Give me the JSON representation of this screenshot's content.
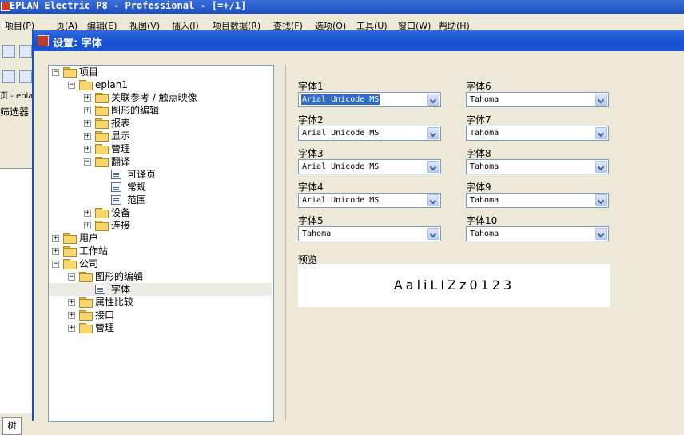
{
  "app": {
    "title": "EPLAN Electric P8 - Professional - [=+/1]",
    "menu": [
      "项目(P)",
      "页(A)",
      "编辑(E)",
      "视图(V)",
      "插入(I)",
      "项目数据(R)",
      "查找(F)",
      "选项(O)",
      "工具(U)",
      "窗口(W)",
      "帮助(H)"
    ],
    "left_text_1": "页 - eplan",
    "left_text_2": "筛选器",
    "tab_tree": "树"
  },
  "dialog": {
    "title": "设置: 字体",
    "tree": [
      {
        "label": "项目",
        "level": 0,
        "exp": "-",
        "icon": "folder"
      },
      {
        "label": "eplan1",
        "level": 1,
        "exp": "-",
        "icon": "folder"
      },
      {
        "label": "关联参考 / 触点映像",
        "level": 2,
        "exp": "+",
        "icon": "folder"
      },
      {
        "label": "图形的编辑",
        "level": 2,
        "exp": "+",
        "icon": "folder"
      },
      {
        "label": "报表",
        "level": 2,
        "exp": "+",
        "icon": "folder"
      },
      {
        "label": "显示",
        "level": 2,
        "exp": "+",
        "icon": "folder"
      },
      {
        "label": "管理",
        "level": 2,
        "exp": "+",
        "icon": "folder"
      },
      {
        "label": "翻译",
        "level": 2,
        "exp": "-",
        "icon": "folder"
      },
      {
        "label": "可译页",
        "level": 3,
        "exp": "",
        "icon": "page"
      },
      {
        "label": "常规",
        "level": 3,
        "exp": "",
        "icon": "page"
      },
      {
        "label": "范围",
        "level": 3,
        "exp": "",
        "icon": "page"
      },
      {
        "label": "设备",
        "level": 2,
        "exp": "+",
        "icon": "folder"
      },
      {
        "label": "连接",
        "level": 2,
        "exp": "+",
        "icon": "folder"
      },
      {
        "label": "用户",
        "level": 0,
        "exp": "+",
        "icon": "folder"
      },
      {
        "label": "工作站",
        "level": 0,
        "exp": "+",
        "icon": "folder"
      },
      {
        "label": "公司",
        "level": 0,
        "exp": "-",
        "icon": "folder"
      },
      {
        "label": "图形的编辑",
        "level": 1,
        "exp": "-",
        "icon": "folder"
      },
      {
        "label": "字体",
        "level": 2,
        "exp": "",
        "icon": "page",
        "selected": true
      },
      {
        "label": "属性比较",
        "level": 1,
        "exp": "+",
        "icon": "folder"
      },
      {
        "label": "接口",
        "level": 1,
        "exp": "+",
        "icon": "folder"
      },
      {
        "label": "管理",
        "level": 1,
        "exp": "+",
        "icon": "folder"
      }
    ],
    "fonts": [
      {
        "label": "字体1",
        "value": "Arial Unicode MS",
        "highlight": true
      },
      {
        "label": "字体2",
        "value": "Arial Unicode MS"
      },
      {
        "label": "字体3",
        "value": "Arial Unicode MS"
      },
      {
        "label": "字体4",
        "value": "Arial Unicode MS"
      },
      {
        "label": "字体5",
        "value": "Tahoma"
      },
      {
        "label": "字体6",
        "value": "Tahoma"
      },
      {
        "label": "字体7",
        "value": "Tahoma"
      },
      {
        "label": "字体8",
        "value": "Tahoma"
      },
      {
        "label": "字体9",
        "value": "Tahoma"
      },
      {
        "label": "字体10",
        "value": "Tahoma"
      }
    ],
    "preview_label": "预览",
    "preview_text": "AaliLIZz0123"
  }
}
